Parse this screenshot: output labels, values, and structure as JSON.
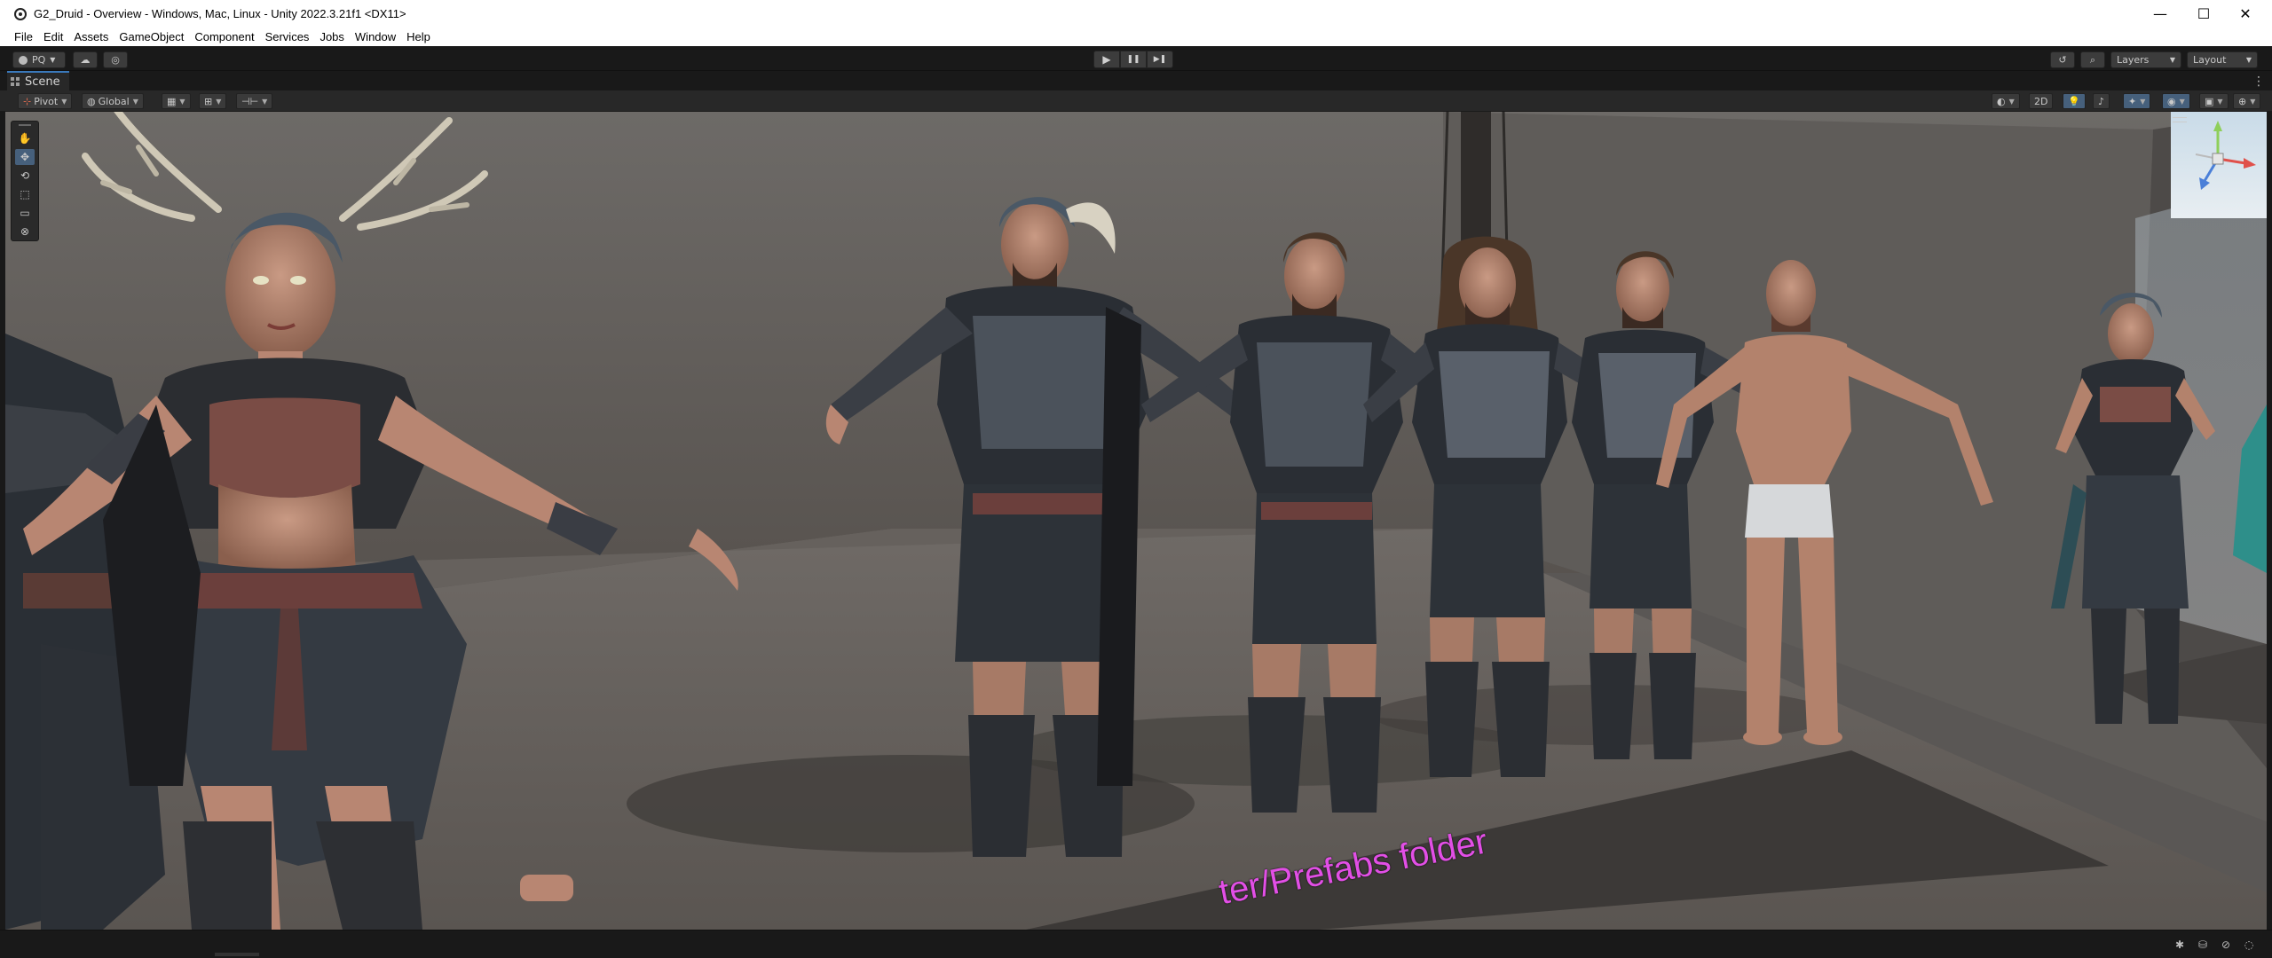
{
  "window": {
    "title": "G2_Druid - Overview - Windows, Mac, Linux - Unity 2022.3.21f1 <DX11>",
    "controls": {
      "minimize": "—",
      "maximize": "☐",
      "close": "✕"
    }
  },
  "menu": [
    "File",
    "Edit",
    "Assets",
    "GameObject",
    "Component",
    "Services",
    "Jobs",
    "Window",
    "Help"
  ],
  "toolbar": {
    "account": "PQ",
    "layers_label": "Layers",
    "layout_label": "Layout",
    "play": "▶",
    "pause": "❚❚",
    "step": "▶❚"
  },
  "scene_tab": {
    "label": "Scene"
  },
  "scene_toolbar": {
    "pivot_label": "Pivot",
    "global_label": "Global",
    "mode_2d": "2D"
  },
  "viewport": {
    "floor_label": "ter/Prefabs folder"
  },
  "colors": {
    "accent": "#3a79bb",
    "selected_tool": "#46607c",
    "floor_text": "#e24fe6"
  }
}
